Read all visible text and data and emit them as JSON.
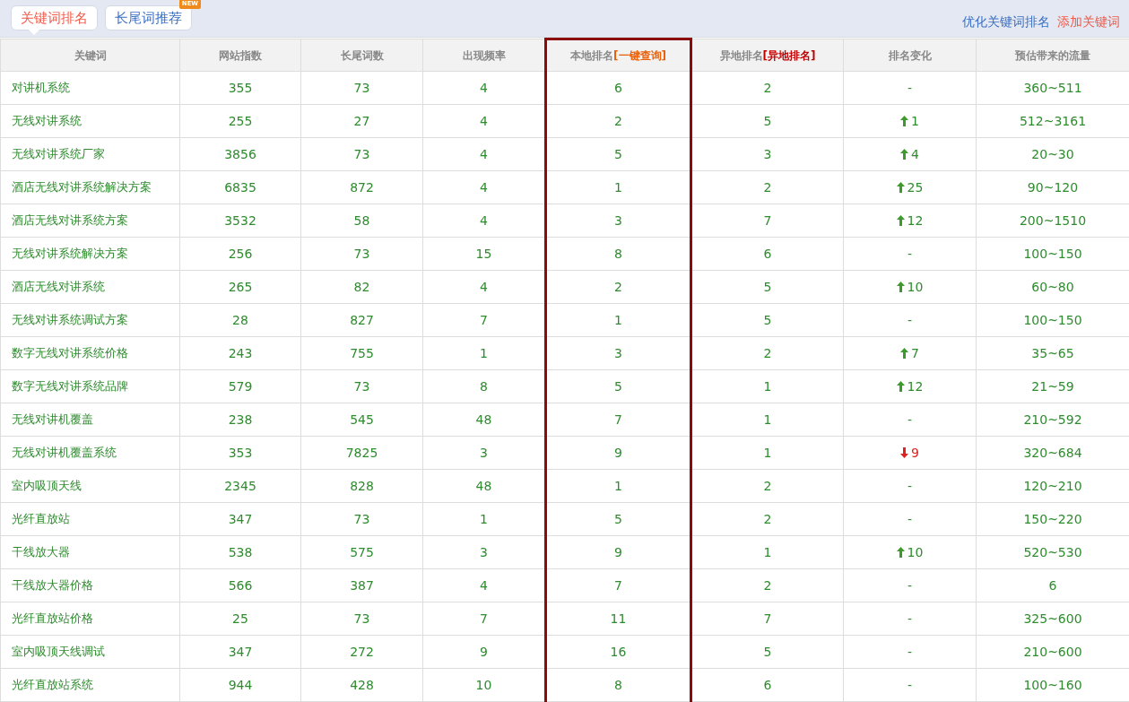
{
  "tabs": [
    {
      "label": "关键词排名",
      "selected": true
    },
    {
      "label": "长尾词推荐",
      "selected": false,
      "badge": "NEW"
    }
  ],
  "actions": [
    {
      "label": "优化关键词排名",
      "kind": "primary"
    },
    {
      "label": "添加关键词",
      "kind": "accent"
    }
  ],
  "table": {
    "columns": [
      {
        "label": "关键词"
      },
      {
        "label": "网站指数"
      },
      {
        "label": "长尾词数"
      },
      {
        "label": "出现频率"
      },
      {
        "label": "本地排名",
        "link": "[一键查询]",
        "highlighted": true
      },
      {
        "label": "异地排名",
        "link": "[异地排名]"
      },
      {
        "label": "排名变化"
      },
      {
        "label": "预估带来的流量"
      }
    ],
    "rows": [
      {
        "keyword": "对讲机系统",
        "index": "355",
        "long_tail": "73",
        "frequency": "4",
        "local_rank": "6",
        "remote_rank": "2",
        "change": {
          "kind": "none",
          "text": "-"
        },
        "traffic": "360~511"
      },
      {
        "keyword": "无线对讲系统",
        "index": "255",
        "long_tail": "27",
        "frequency": "4",
        "local_rank": "2",
        "remote_rank": "5",
        "change": {
          "kind": "up",
          "text": "1"
        },
        "traffic": "512~3161"
      },
      {
        "keyword": "无线对讲系统厂家",
        "index": "3856",
        "long_tail": "73",
        "frequency": "4",
        "local_rank": "5",
        "remote_rank": "3",
        "change": {
          "kind": "up",
          "text": "4"
        },
        "traffic": "20~30"
      },
      {
        "keyword": "酒店无线对讲系统解决方案",
        "index": "6835",
        "long_tail": "872",
        "frequency": "4",
        "local_rank": "1",
        "remote_rank": "2",
        "change": {
          "kind": "up",
          "text": "25"
        },
        "traffic": "90~120"
      },
      {
        "keyword": "酒店无线对讲系统方案",
        "index": "3532",
        "long_tail": "58",
        "frequency": "4",
        "local_rank": "3",
        "remote_rank": "7",
        "change": {
          "kind": "up",
          "text": "12"
        },
        "traffic": "200~1510"
      },
      {
        "keyword": "无线对讲系统解决方案",
        "index": "256",
        "long_tail": "73",
        "frequency": "15",
        "local_rank": "8",
        "remote_rank": "6",
        "change": {
          "kind": "none",
          "text": "-"
        },
        "traffic": "100~150"
      },
      {
        "keyword": "酒店无线对讲系统",
        "index": "265",
        "long_tail": "82",
        "frequency": "4",
        "local_rank": "2",
        "remote_rank": "5",
        "change": {
          "kind": "up",
          "text": "10"
        },
        "traffic": "60~80"
      },
      {
        "keyword": "无线对讲系统调试方案",
        "index": "28",
        "long_tail": "827",
        "frequency": "7",
        "local_rank": "1",
        "remote_rank": "5",
        "change": {
          "kind": "none",
          "text": "-"
        },
        "traffic": "100~150"
      },
      {
        "keyword": "数字无线对讲系统价格",
        "index": "243",
        "long_tail": "755",
        "frequency": "1",
        "local_rank": "3",
        "remote_rank": "2",
        "change": {
          "kind": "up",
          "text": "7"
        },
        "traffic": "35~65"
      },
      {
        "keyword": "数字无线对讲系统品牌",
        "index": "579",
        "long_tail": "73",
        "frequency": "8",
        "local_rank": "5",
        "remote_rank": "1",
        "change": {
          "kind": "up",
          "text": "12"
        },
        "traffic": "21~59"
      },
      {
        "keyword": "无线对讲机覆盖",
        "index": "238",
        "long_tail": "545",
        "frequency": "48",
        "local_rank": "7",
        "remote_rank": "1",
        "change": {
          "kind": "none",
          "text": "-"
        },
        "traffic": "210~592"
      },
      {
        "keyword": "无线对讲机覆盖系统",
        "index": "353",
        "long_tail": "7825",
        "frequency": "3",
        "local_rank": "9",
        "remote_rank": "1",
        "change": {
          "kind": "down",
          "text": "9"
        },
        "traffic": "320~684"
      },
      {
        "keyword": "室内吸顶天线",
        "index": "2345",
        "long_tail": "828",
        "frequency": "48",
        "local_rank": "1",
        "remote_rank": "2",
        "change": {
          "kind": "none",
          "text": "-"
        },
        "traffic": "120~210"
      },
      {
        "keyword": "光纤直放站",
        "index": "347",
        "long_tail": "73",
        "frequency": "1",
        "local_rank": "5",
        "remote_rank": "2",
        "change": {
          "kind": "none",
          "text": "-"
        },
        "traffic": "150~220"
      },
      {
        "keyword": "干线放大器",
        "index": "538",
        "long_tail": "575",
        "frequency": "3",
        "local_rank": "9",
        "remote_rank": "1",
        "change": {
          "kind": "up",
          "text": "10"
        },
        "traffic": "520~530"
      },
      {
        "keyword": "干线放大器价格",
        "index": "566",
        "long_tail": "387",
        "frequency": "4",
        "local_rank": "7",
        "remote_rank": "2",
        "change": {
          "kind": "none",
          "text": "-"
        },
        "traffic": "6"
      },
      {
        "keyword": "光纤直放站价格",
        "index": "25",
        "long_tail": "73",
        "frequency": "7",
        "local_rank": "11",
        "remote_rank": "7",
        "change": {
          "kind": "none",
          "text": "-"
        },
        "traffic": "325~600"
      },
      {
        "keyword": "室内吸顶天线调试",
        "index": "347",
        "long_tail": "272",
        "frequency": "9",
        "local_rank": "16",
        "remote_rank": "5",
        "change": {
          "kind": "none",
          "text": "-"
        },
        "traffic": "210~600"
      },
      {
        "keyword": "光纤直放站系统",
        "index": "944",
        "long_tail": "428",
        "frequency": "10",
        "local_rank": "8",
        "remote_rank": "6",
        "change": {
          "kind": "none",
          "text": "-"
        },
        "traffic": "100~160"
      }
    ]
  }
}
